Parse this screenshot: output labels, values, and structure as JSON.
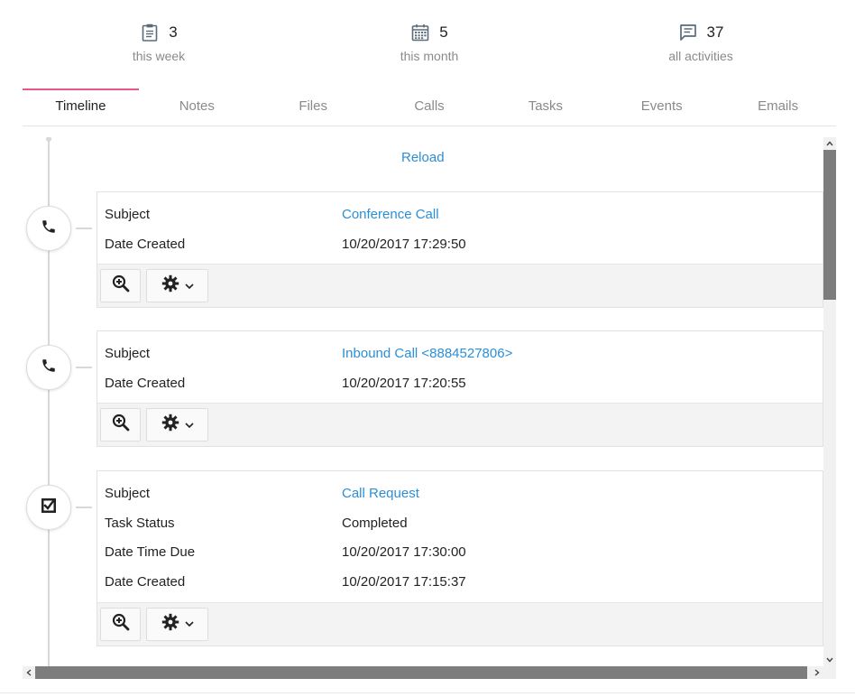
{
  "stats": [
    {
      "icon": "clipboard-icon",
      "count": "3",
      "label": "this week"
    },
    {
      "icon": "calendar-icon",
      "count": "5",
      "label": "this month"
    },
    {
      "icon": "comment-icon",
      "count": "37",
      "label": "all activities"
    }
  ],
  "tabs": [
    {
      "label": "Timeline",
      "active": true
    },
    {
      "label": "Notes"
    },
    {
      "label": "Files"
    },
    {
      "label": "Calls"
    },
    {
      "label": "Tasks"
    },
    {
      "label": "Events"
    },
    {
      "label": "Emails"
    }
  ],
  "reload_label": "Reload",
  "entries": [
    {
      "icon": "phone-icon",
      "fields": [
        {
          "key": "Subject",
          "value": "Conference Call",
          "link": true
        },
        {
          "key": "Date Created",
          "value": "10/20/2017 17:29:50"
        }
      ]
    },
    {
      "icon": "phone-icon",
      "fields": [
        {
          "key": "Subject",
          "value": "Inbound Call <8884527806>",
          "link": true
        },
        {
          "key": "Date Created",
          "value": "10/20/2017 17:20:55"
        }
      ]
    },
    {
      "icon": "task-check-icon",
      "fields": [
        {
          "key": "Subject",
          "value": "Call Request",
          "link": true
        },
        {
          "key": "Task Status",
          "value": "Completed"
        },
        {
          "key": "Date Time Due",
          "value": "10/20/2017 17:30:00"
        },
        {
          "key": "Date Created",
          "value": "10/20/2017 17:15:37"
        }
      ]
    }
  ],
  "colors": {
    "accent": "#e8578c",
    "link": "#2b8fd6"
  }
}
